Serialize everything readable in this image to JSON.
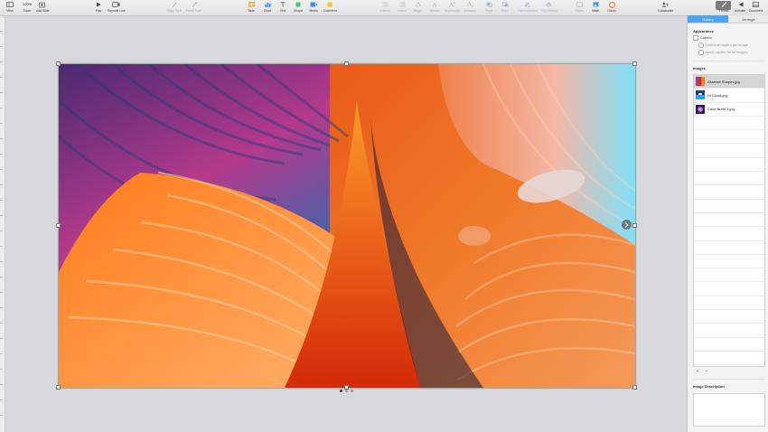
{
  "toolbar": {
    "view": "View",
    "zoom_value": "100%",
    "zoom": "Zoom",
    "add_slide": "Add Slide",
    "play": "Play",
    "keynote_live": "Keynote Live",
    "copy_style": "Copy Style",
    "paste_style": "Paste Style",
    "table": "Table",
    "chart": "Chart",
    "text": "Text",
    "shape": "Shape",
    "media": "Media",
    "comment": "Comment",
    "outdent": "Outdent",
    "indent": "Indent",
    "bigger": "Bigger",
    "smaller": "Smaller",
    "superscript": "Superscript",
    "subscript": "Subscript",
    "front": "Front",
    "back": "Back",
    "flip_horizontal": "Flip Horizontal",
    "flip_vertical": "Flip Vertical",
    "styles": "Styles",
    "mask": "Mask",
    "colors": "Colors",
    "collaborate": "Collaborate",
    "format": "Format",
    "animate": "Animate",
    "document": "Document"
  },
  "inspector": {
    "tabs": [
      "Gallery",
      "Arrange"
    ],
    "appearance_title": "Appearance",
    "caption_label": "Caption",
    "option1": "Individual caption per image",
    "option2": "Same caption for all images",
    "images_title": "Images",
    "images": [
      {
        "name": "Abstract Shapes.jpg"
      },
      {
        "name": "Hi Cloud.jpg"
      },
      {
        "name": "Color Burst 3.jpg"
      }
    ],
    "add": "+",
    "remove": "−",
    "description_title": "Image Description"
  },
  "colors": {
    "accent": "#4aa3f5",
    "selected_row": "#d5d5d5"
  }
}
